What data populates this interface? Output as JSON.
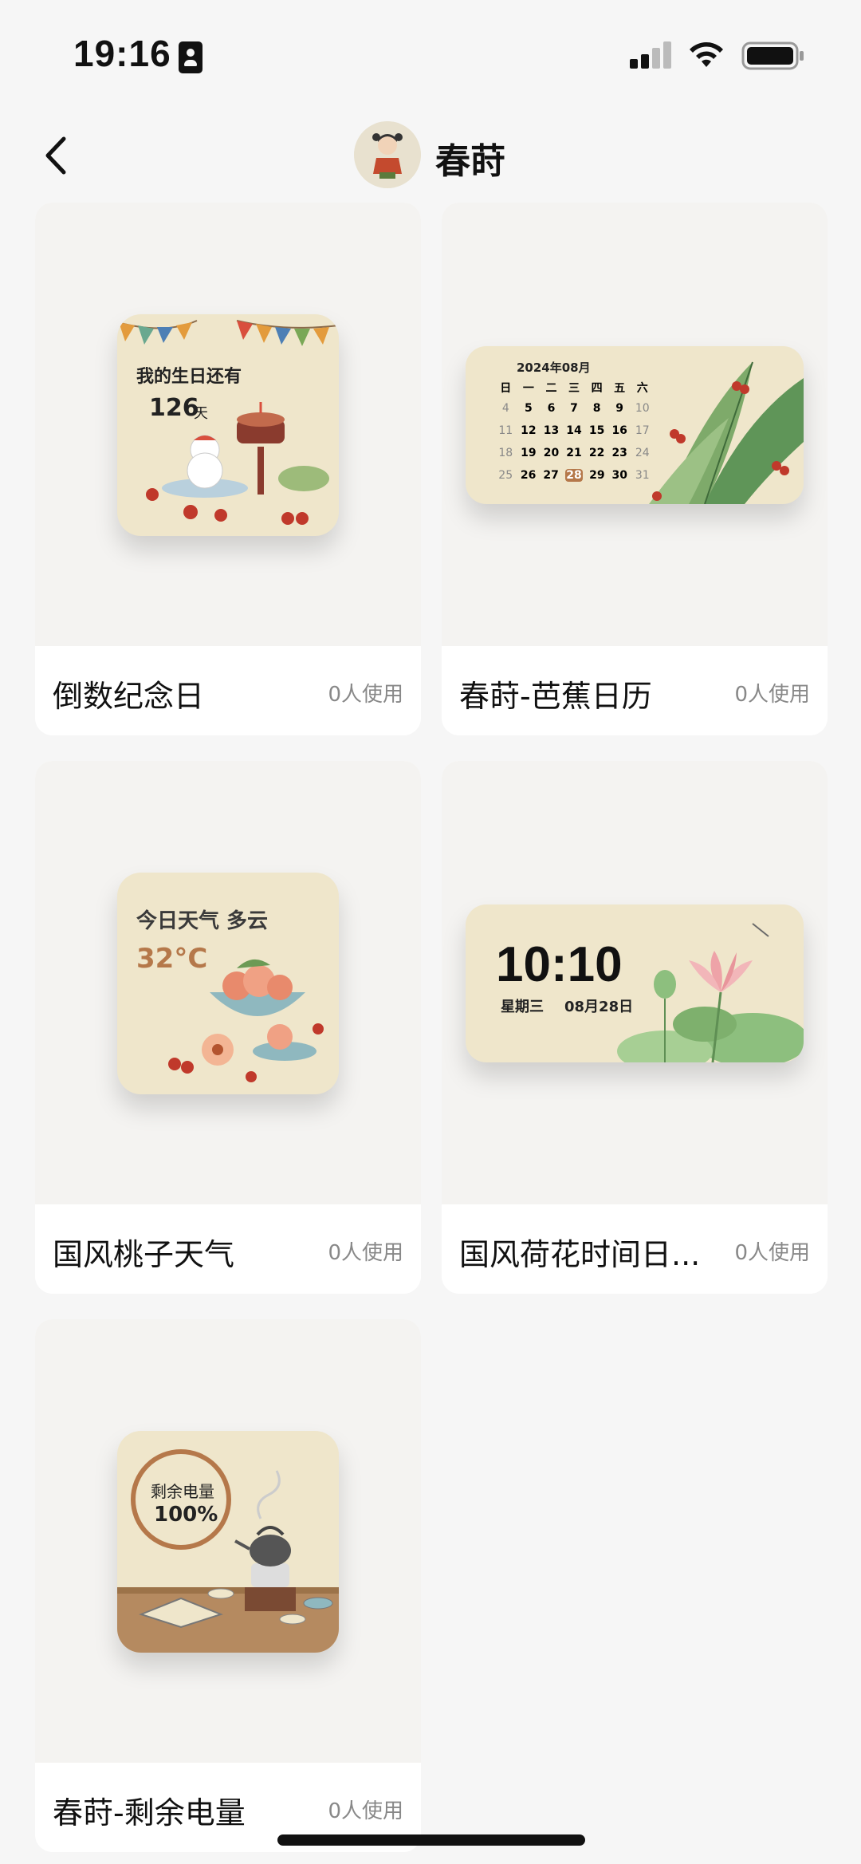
{
  "status_bar": {
    "time": "19:16"
  },
  "nav": {
    "title": "春莳"
  },
  "cards": [
    {
      "name": "倒数纪念日",
      "usage": "0人使用",
      "widget": {
        "line1": "我的生日还有",
        "days": "126",
        "unit": "天"
      }
    },
    {
      "name": "春莳-芭蕉日历",
      "usage": "0人使用",
      "widget": {
        "month": "2024年08月",
        "weekdays": [
          "日",
          "一",
          "二",
          "三",
          "四",
          "五",
          "六"
        ],
        "rows": [
          [
            "4",
            "5",
            "6",
            "7",
            "8",
            "9",
            "10"
          ],
          [
            "11",
            "12",
            "13",
            "14",
            "15",
            "16",
            "17"
          ],
          [
            "18",
            "19",
            "20",
            "21",
            "22",
            "23",
            "24"
          ],
          [
            "25",
            "26",
            "27",
            "28",
            "29",
            "30",
            "31"
          ]
        ],
        "highlight": "28"
      }
    },
    {
      "name": "国风桃子天气",
      "usage": "0人使用",
      "widget": {
        "weather": "今日天气 多云",
        "temp": "32°C"
      }
    },
    {
      "name": "国风荷花时间日...",
      "usage": "0人使用",
      "widget": {
        "time": "10:10",
        "weekday": "星期三",
        "date": "08月28日"
      }
    },
    {
      "name": "春莳-剩余电量",
      "usage": "0人使用",
      "widget": {
        "label": "剩余电量",
        "percent": "100%"
      }
    }
  ],
  "colors": {
    "accent": "#b5784a",
    "widget_bg": "#efe6cb",
    "leaf": "#6fa765"
  }
}
